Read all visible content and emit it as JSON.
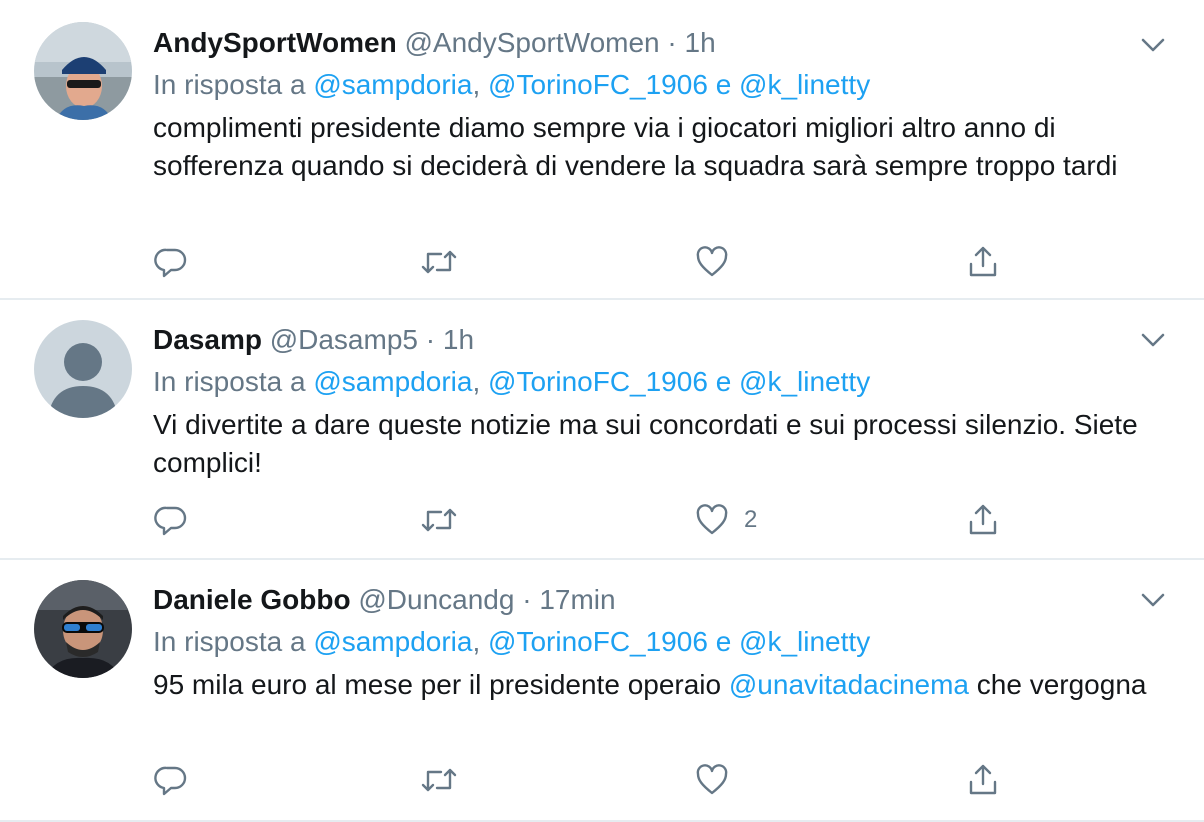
{
  "tweets": [
    {
      "display_name": "AndySportWomen",
      "handle": "@AndySportWomen",
      "separator": "·",
      "time": "1h",
      "reply_prefix": "In risposta a",
      "reply_to": [
        "@sampdoria",
        "@TorinoFC_1906",
        "@k_linetty"
      ],
      "reply_sep_comma": ",",
      "reply_sep_and": "e",
      "text": "complimenti presidente  diamo sempre via i giocatori migliori altro anno di sofferenza quando si deciderà di vendere la squadra sarà sempre troppo tardi",
      "like_count": ""
    },
    {
      "display_name": "Dasamp",
      "handle": "@Dasamp5",
      "separator": "·",
      "time": "1h",
      "reply_prefix": "In risposta a",
      "reply_to": [
        "@sampdoria",
        "@TorinoFC_1906",
        "@k_linetty"
      ],
      "reply_sep_comma": ",",
      "reply_sep_and": "e",
      "text": "Vi divertite a dare queste notizie ma sui concordati e sui processi silenzio. Siete complici!",
      "like_count": "2"
    },
    {
      "display_name": "Daniele Gobbo",
      "handle": "@Duncandg",
      "separator": "·",
      "time": "17min",
      "reply_prefix": "In risposta a",
      "reply_to": [
        "@sampdoria",
        "@TorinoFC_1906",
        "@k_linetty"
      ],
      "reply_sep_comma": ",",
      "reply_sep_and": "e",
      "text_before_mention": "95 mila euro al mese per il presidente operaio ",
      "text_mention": "@unavitadacinema",
      "text_after_mention": " che vergogna",
      "like_count": ""
    }
  ],
  "icons": {
    "caret": "chevron-down-icon",
    "reply": "reply-icon",
    "retweet": "retweet-icon",
    "like": "heart-icon",
    "share": "share-icon"
  },
  "colors": {
    "link": "#1da1f2",
    "secondary_text": "#657786",
    "primary_text": "#14171a",
    "divider": "#e6ecf0"
  }
}
